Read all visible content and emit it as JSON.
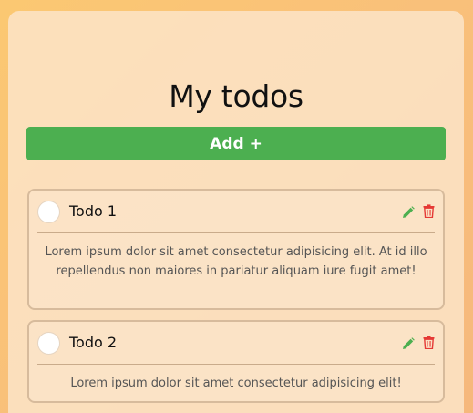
{
  "header": {
    "title": "My todos"
  },
  "toolbar": {
    "add_label": "Add +"
  },
  "colors": {
    "accent": "#4caf50",
    "edit": "#4caf50",
    "delete": "#e53935"
  },
  "todos": [
    {
      "title": "Todo 1",
      "description": "Lorem ipsum dolor sit amet consectetur adipisicing elit. At id illo repellendus non maiores in pariatur aliquam iure fugit amet!",
      "completed": false,
      "edit_icon": "pencil-icon",
      "delete_icon": "trash-icon"
    },
    {
      "title": "Todo 2",
      "description": "Lorem ipsum dolor sit amet consectetur adipisicing elit!",
      "completed": false,
      "edit_icon": "pencil-icon",
      "delete_icon": "trash-icon"
    }
  ]
}
